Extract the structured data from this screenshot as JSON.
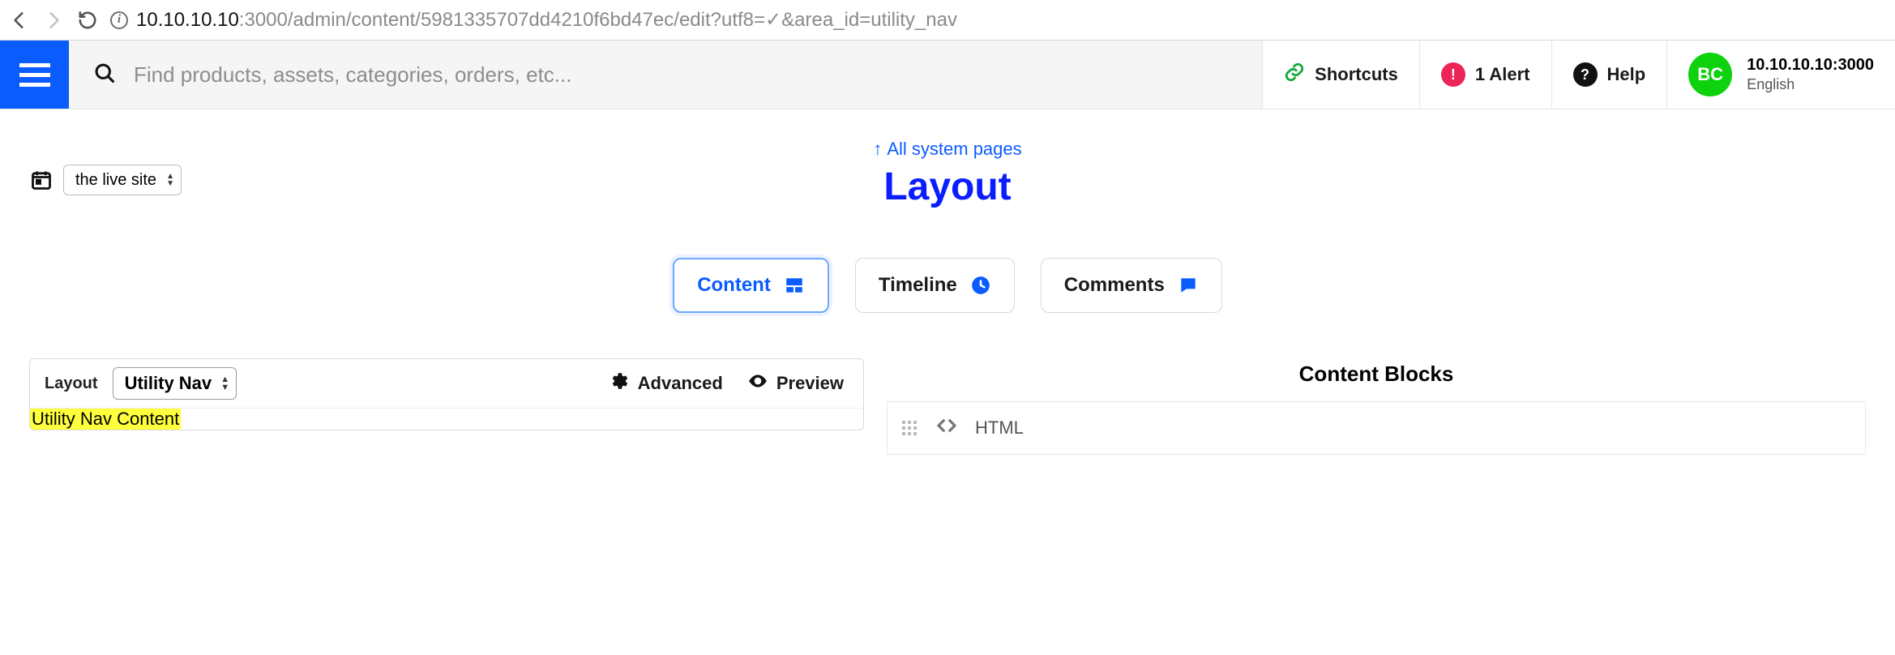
{
  "browser": {
    "url_host": "10.10.10.10",
    "url_rest": ":3000/admin/content/5981335707dd4210f6bd47ec/edit?utf8=✓&area_id=utility_nav"
  },
  "topbar": {
    "search_placeholder": "Find products, assets, categories, orders, etc...",
    "shortcuts_label": "Shortcuts",
    "alert_label": "1 Alert",
    "help_label": "Help",
    "avatar_initials": "BC",
    "user_host": "10.10.10.10:3000",
    "user_lang": "English"
  },
  "page": {
    "back_link": "All system pages",
    "title": "Layout",
    "site_select": "the live site"
  },
  "tabs": {
    "content": "Content",
    "timeline": "Timeline",
    "comments": "Comments"
  },
  "editor": {
    "layout_label": "Layout",
    "area_select": "Utility Nav",
    "advanced_label": "Advanced",
    "preview_label": "Preview",
    "highlight_text": "Utility Nav Content"
  },
  "sidebar": {
    "title": "Content Blocks",
    "blocks": {
      "html": "HTML"
    }
  }
}
